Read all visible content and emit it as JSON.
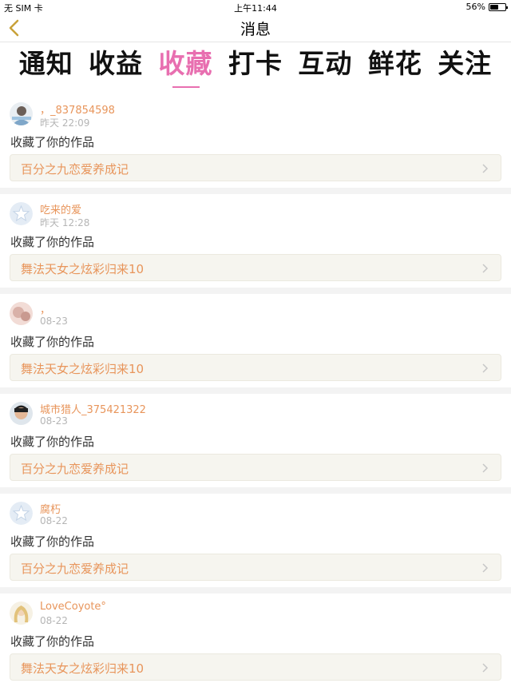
{
  "status_bar": {
    "carrier": "无 SIM 卡",
    "time": "上午11:44",
    "battery": "56%",
    "battery_level": 0.56
  },
  "nav": {
    "title": "消息"
  },
  "tabs": [
    {
      "label": "通知"
    },
    {
      "label": "收益"
    },
    {
      "label": "收藏"
    },
    {
      "label": "打卡"
    },
    {
      "label": "互动"
    },
    {
      "label": "鲜花"
    },
    {
      "label": "关注"
    }
  ],
  "active_tab": "收藏",
  "items": [
    {
      "user": "，_837854598",
      "time": "昨天 22:09",
      "action": "收藏了你的作品",
      "work": "百分之九恋爱养成记",
      "avatar": "photo-icon"
    },
    {
      "user": "吃来的爱",
      "time": "昨天 12:28",
      "action": "收藏了你的作品",
      "work": "舞法天女之炫彩归来10",
      "avatar": "default-star-icon"
    },
    {
      "user": "，",
      "time": "08-23",
      "action": "收藏了你的作品",
      "work": "舞法天女之炫彩归来10",
      "avatar": "photo-icon"
    },
    {
      "user": "城市猎人_375421322",
      "time": "08-23",
      "action": "收藏了你的作品",
      "work": "百分之九恋爱养成记",
      "avatar": "photo-icon"
    },
    {
      "user": "腐朽",
      "time": "08-22",
      "action": "收藏了你的作品",
      "work": "百分之九恋爱养成记",
      "avatar": "default-star-icon"
    },
    {
      "user": "LoveCoyote°",
      "time": "08-22",
      "action": "收藏了你的作品",
      "work": "舞法天女之炫彩归来10",
      "avatar": "photo-icon"
    }
  ],
  "colors": {
    "accent": "#e86fb0",
    "name": "#e8955b",
    "back_icon": "#c8a23a"
  }
}
